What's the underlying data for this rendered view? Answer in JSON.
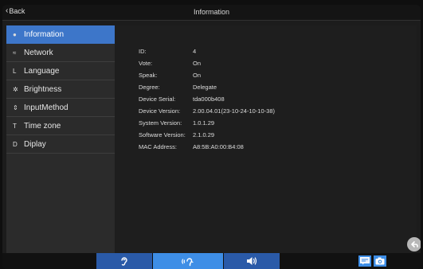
{
  "header": {
    "back_label": "Back",
    "title": "Information"
  },
  "sidebar": {
    "items": [
      {
        "label": "Information",
        "icon": "bubble-icon",
        "glyph": "●",
        "active": true
      },
      {
        "label": "Network",
        "icon": "wifi-icon",
        "glyph": "≈",
        "active": false
      },
      {
        "label": "Language",
        "icon": "language-icon",
        "glyph": "L",
        "active": false
      },
      {
        "label": "Brightness",
        "icon": "brightness-icon",
        "glyph": "✲",
        "active": false
      },
      {
        "label": "InputMethod",
        "icon": "input-method-icon",
        "glyph": "⇕",
        "active": false
      },
      {
        "label": "Time zone",
        "icon": "time-zone-icon",
        "glyph": "T",
        "active": false
      },
      {
        "label": "Diplay",
        "icon": "display-icon",
        "glyph": "D",
        "active": false
      }
    ]
  },
  "info": [
    {
      "label": "ID:",
      "value": "4"
    },
    {
      "label": "Vote:",
      "value": "On"
    },
    {
      "label": "Speak:",
      "value": "On"
    },
    {
      "label": "Degree:",
      "value": "Delegate"
    },
    {
      "label": "Device Serial:",
      "value": "tda000b408"
    },
    {
      "label": "Device Version:",
      "value": "2.00.04.01(23-10-24-10-10-38)"
    },
    {
      "label": "System Version:",
      "value": "1.0.1.29"
    },
    {
      "label": "Software Version:",
      "value": "2.1.0.29"
    },
    {
      "label": "MAC Address:",
      "value": "A8:5B:A0:00:B4:08"
    }
  ],
  "bottombar": {
    "tabs": [
      "ear-icon",
      "speak-icon",
      "volume-icon"
    ],
    "buttons": [
      "chat-icon",
      "camera-icon"
    ]
  },
  "colors": {
    "accent": "#3d76c9",
    "bottom_tab_bright": "#3e8ee6",
    "bottom_tab_dark": "#2a5aa8",
    "sidebar_bg": "#2b2b2b",
    "content_bg": "#1e1e1e"
  }
}
